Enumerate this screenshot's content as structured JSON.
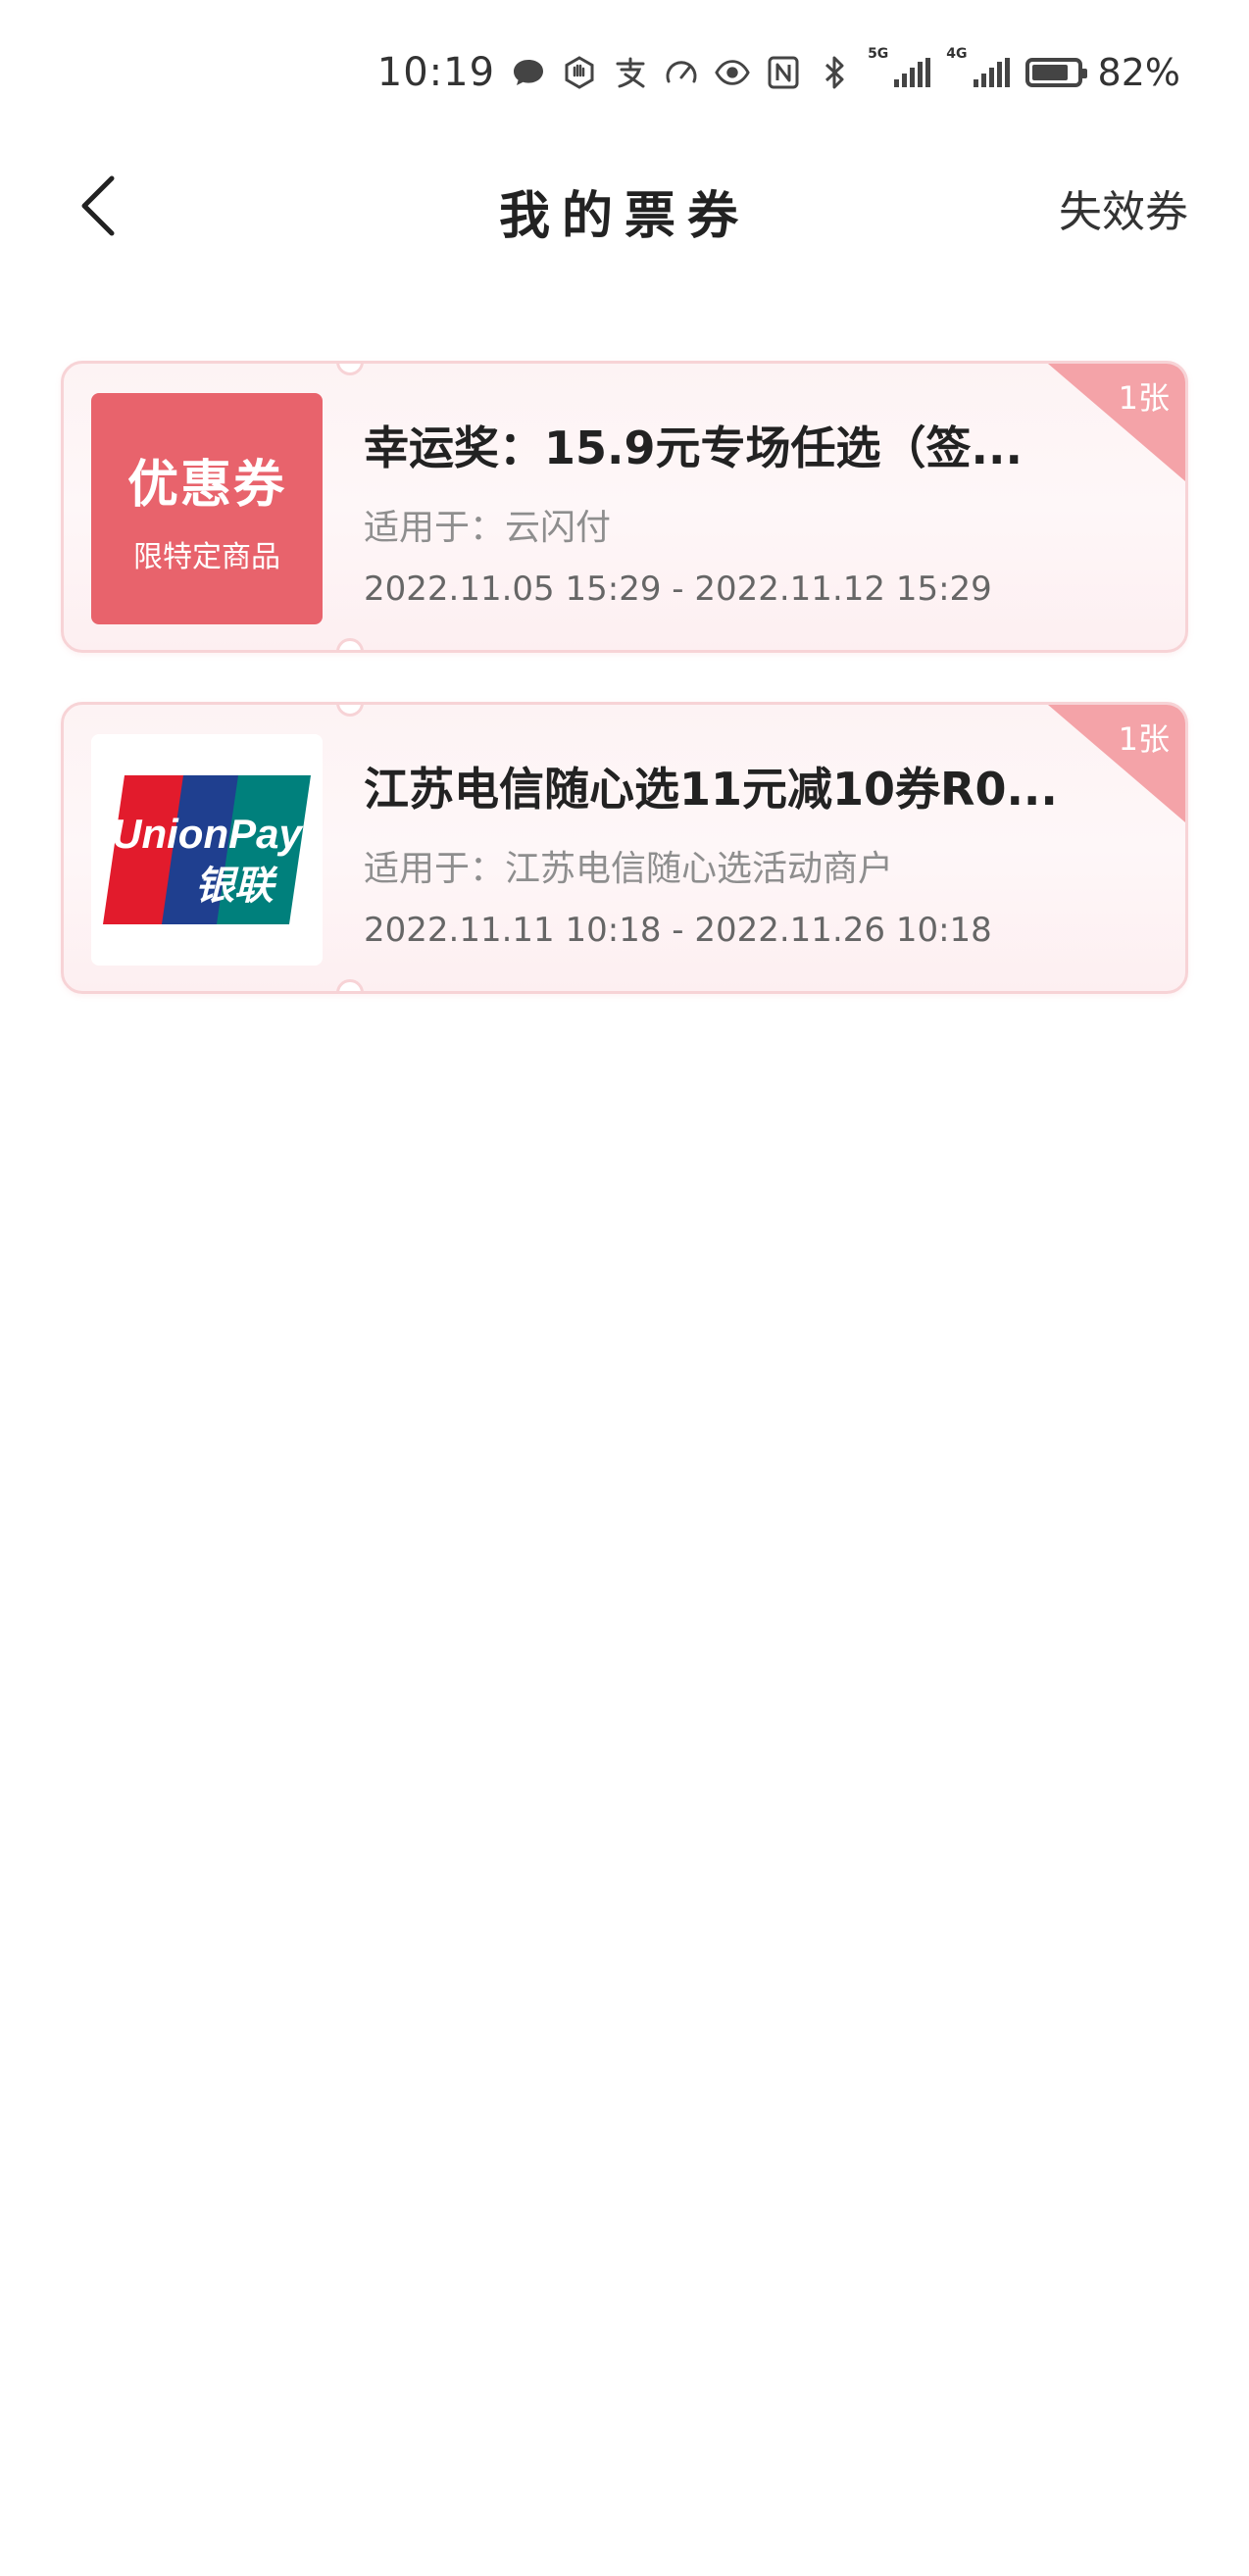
{
  "status_bar": {
    "time": "10:19",
    "network_5g": "5G",
    "network_4g": "4G",
    "battery_percent": "82%",
    "battery_level": 0.82,
    "icons": [
      "message-icon",
      "hand-icon",
      "alipay-icon",
      "speed-icon",
      "eye-icon",
      "nfc-icon",
      "bluetooth-icon",
      "signal-5g-icon",
      "signal-4g-icon",
      "battery-icon"
    ]
  },
  "nav": {
    "title": "我的票券",
    "right_link": "失效券"
  },
  "coupons": [
    {
      "thumb_type": "red",
      "thumb_title": "优惠券",
      "thumb_subtitle": "限特定商品",
      "title": "幸运奖：15.9元专场任选（签...",
      "apply": "适用于：云闪付",
      "date": "2022.11.05 15:29 - 2022.11.12 15:29",
      "count_badge": "1张"
    },
    {
      "thumb_type": "unionpay",
      "logo_text_en": "UnionPay",
      "logo_text_cn": "银联",
      "title": "江苏电信随心选11元减10券R0...",
      "apply": "适用于：江苏电信随心选活动商户",
      "date": "2022.11.11 10:18 - 2022.11.26 10:18",
      "count_badge": "1张"
    }
  ],
  "colors": {
    "accent": "#e8636c",
    "badge": "#f4a3a8",
    "unionpay_red": "#e21b2c",
    "unionpay_blue": "#1f3f8f",
    "unionpay_teal": "#00807c"
  }
}
